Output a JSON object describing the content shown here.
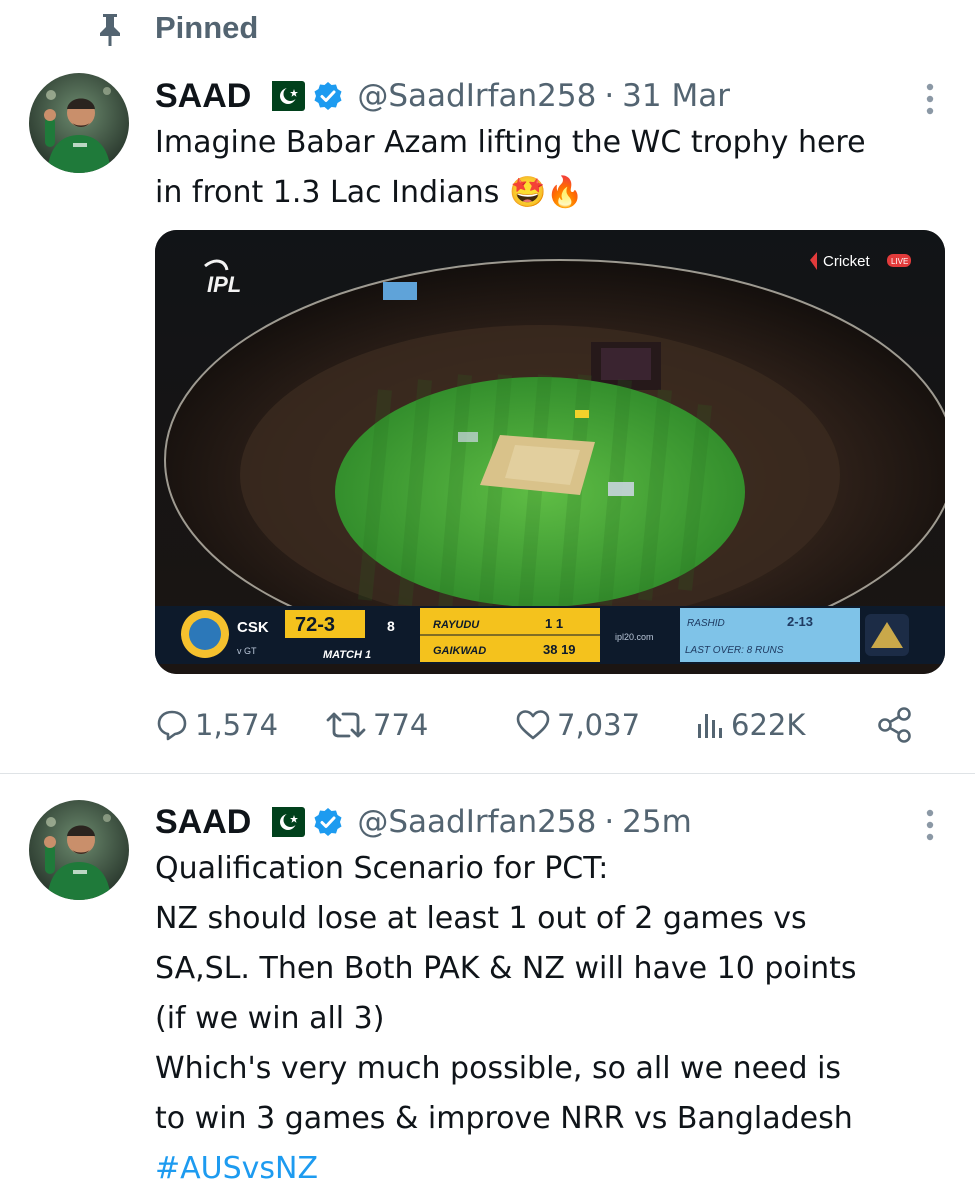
{
  "pinned": {
    "label": "Pinned",
    "icon": "pin-icon"
  },
  "tweets": [
    {
      "name": "SAAD",
      "flag": "pakistan-flag-icon",
      "handle": "@SaadIrfan258",
      "separator": "·",
      "time": "31 Mar",
      "text_lines": [
        "Imagine Babar Azam lifting the WC trophy here",
        "in front 1.3 Lac Indians 🤩🔥"
      ],
      "media": {
        "logo": "IPL",
        "broadcaster": "Cricket",
        "scoreboard": {
          "team": "CSK",
          "vs": "v GT",
          "score": "72-3",
          "overs": "8",
          "match": "MATCH 1",
          "batter1": "RAYUDU",
          "batter1_score": "1 1",
          "batter2": "GAIKWAD",
          "batter2_score": "38 19",
          "site": "ipl20.com",
          "bowler": "RASHID",
          "bowler_figures": "2-13",
          "last_over": "LAST OVER: 8 RUNS"
        }
      },
      "stats": {
        "replies": "1,574",
        "retweets": "774",
        "likes": "7,037",
        "views": "622K"
      }
    },
    {
      "name": "SAAD",
      "flag": "pakistan-flag-icon",
      "handle": "@SaadIrfan258",
      "separator": "·",
      "time": "25m",
      "text_lines": [
        "Qualification Scenario for PCT:",
        "NZ should lose at least 1 out of 2 games vs",
        "SA,SL. Then Both PAK & NZ will have 10 points",
        "(if we win all 3)",
        "Which's very much possible, so all we need is",
        "to win 3 games & improve NRR vs Bangladesh"
      ],
      "hashtag": "#AUSvsNZ"
    }
  ],
  "colors": {
    "accent": "#1d9bf0",
    "secondary_text": "#536471",
    "primary_text": "#0f1419",
    "pakistan_green": "#01411c"
  }
}
